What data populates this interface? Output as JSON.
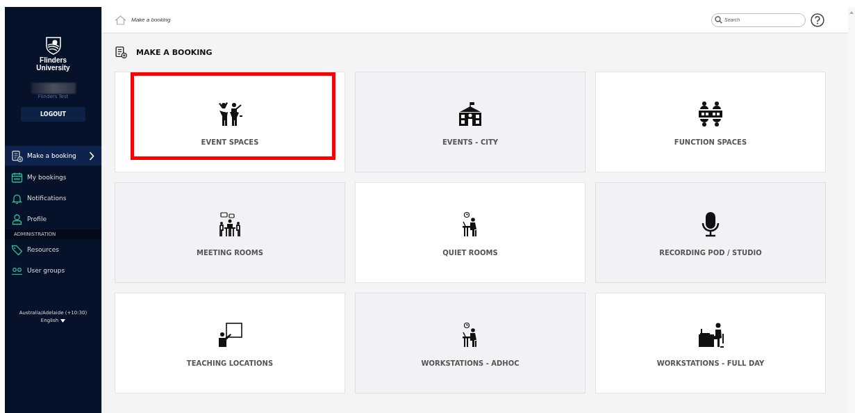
{
  "sidebar": {
    "logo_text": "Flinders University",
    "user_name": "Flinders Test",
    "logout": "LOGOUT",
    "items": [
      {
        "label": "Make a booking",
        "selected": true,
        "kind": "item"
      },
      {
        "label": "My bookings",
        "selected": false,
        "kind": "item"
      },
      {
        "label": "Notifications",
        "selected": false,
        "kind": "item"
      },
      {
        "label": "Profile",
        "selected": false,
        "kind": "item"
      },
      {
        "label": "ADMINISTRATION",
        "kind": "header"
      },
      {
        "label": "Resources",
        "selected": false,
        "kind": "item"
      },
      {
        "label": "User groups",
        "selected": false,
        "kind": "item"
      }
    ],
    "timezone": "Australia/Adelaide (+10:30)",
    "language": "English"
  },
  "topbar": {
    "breadcrumb": "Make a booking",
    "search": {
      "placeholder": "Search"
    }
  },
  "page_title": "MAKE A BOOKING",
  "cards": [
    {
      "label": "EVENT SPACES",
      "shaded": false,
      "outlined": true
    },
    {
      "label": "EVENTS - CITY",
      "shaded": true,
      "outlined": false
    },
    {
      "label": "FUNCTION SPACES",
      "shaded": false,
      "outlined": false
    },
    {
      "label": "MEETING ROOMS",
      "shaded": true,
      "outlined": false
    },
    {
      "label": "QUIET ROOMS",
      "shaded": false,
      "outlined": false
    },
    {
      "label": "RECORDING POD / STUDIO",
      "shaded": true,
      "outlined": false
    },
    {
      "label": "TEACHING LOCATIONS",
      "shaded": false,
      "outlined": false
    },
    {
      "label": "WORKSTATIONS - ADHOC",
      "shaded": true,
      "outlined": false
    },
    {
      "label": "WORKSTATIONS - FULL DAY",
      "shaded": false,
      "outlined": false
    }
  ]
}
